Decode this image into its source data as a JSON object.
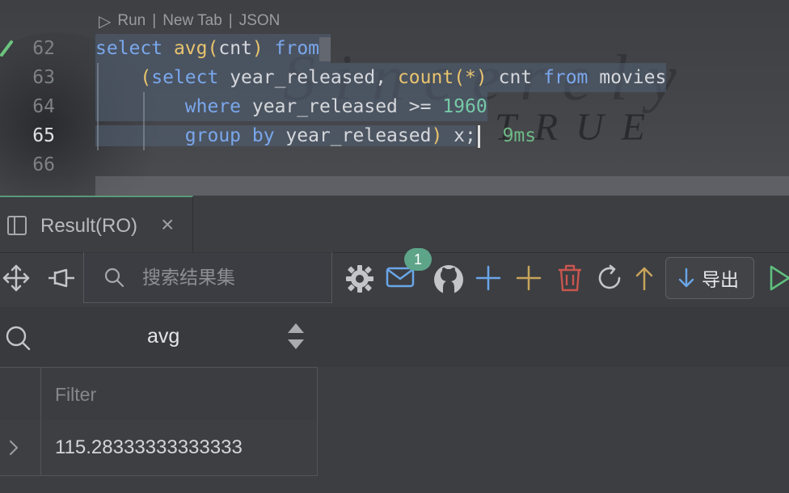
{
  "codelens": {
    "run": "Run",
    "sep1": "|",
    "new_tab": "New Tab",
    "sep2": "|",
    "json": "JSON"
  },
  "editor": {
    "lines": [
      {
        "number": "62"
      },
      {
        "number": "63"
      },
      {
        "number": "64"
      },
      {
        "number": "65"
      },
      {
        "number": "66"
      }
    ],
    "sql": {
      "l62_select": "select",
      "l62_avg": "avg",
      "l62_open": "(",
      "l62_cnt": "cnt",
      "l62_close": ")",
      "l62_from": "from",
      "l63_open": "(",
      "l63_select": "select",
      "l63_col": "year_released,",
      "l63_count": "count",
      "l63_star": "(*)",
      "l63_cnt": "cnt",
      "l63_from": "from",
      "l63_table": "movies",
      "l64_where": "where",
      "l64_cond": "year_released >=",
      "l64_num": "1960",
      "l65_group": "group by",
      "l65_col": "year_released",
      "l65_close": ")",
      "l65_alias": "x;"
    },
    "exec_time": "9ms"
  },
  "result_tab": {
    "label": "Result(RO)",
    "close": "×"
  },
  "toolbar": {
    "search_placeholder": "搜索结果集",
    "notification_count": "1",
    "export_label": "导出"
  },
  "column_header": {
    "name": "avg"
  },
  "grid": {
    "filter_placeholder": "Filter",
    "rows": [
      {
        "value": "115.28333333333333"
      }
    ]
  },
  "watermark": {
    "line1": "Sincerely",
    "line2": "TRUE"
  },
  "colors": {
    "keyword": "#7aa7ec",
    "function": "#e9c46e",
    "number": "#76c9a6",
    "tab_accent": "#5a9a78",
    "badge": "#5ea489",
    "icon_blue": "#6aa6e8",
    "icon_red": "#c9564f",
    "icon_yellow": "#c8a45a"
  }
}
